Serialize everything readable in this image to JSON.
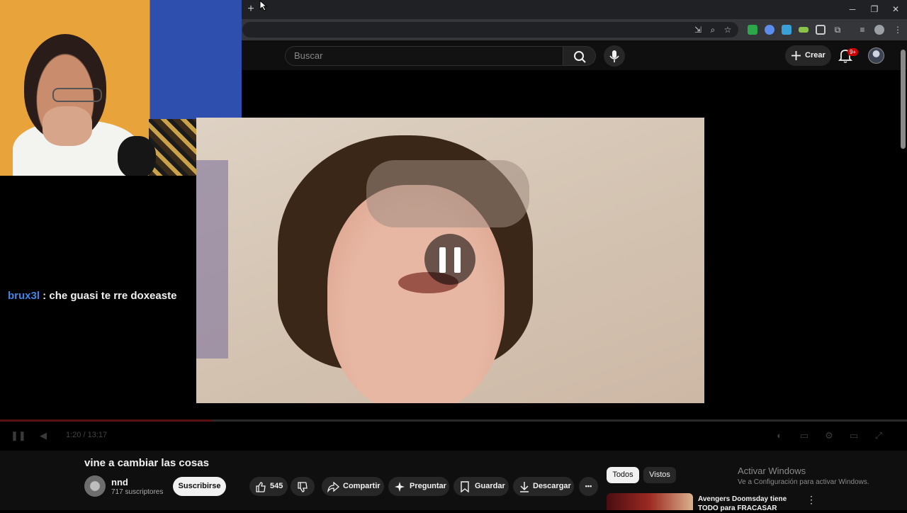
{
  "browser": {
    "new_tab_glyph": "+",
    "window_controls": {
      "minimize": "─",
      "restore": "❐",
      "close": "✕"
    }
  },
  "header": {
    "search_placeholder": "Buscar",
    "create_label": "Crear",
    "notifications_badge": "9+"
  },
  "stream_overlay": {
    "chat_user": "brux3l",
    "chat_message": " : che guasi te rre doxeaste"
  },
  "player": {
    "time": "1:20 / 13:17",
    "state": "paused",
    "progress_fraction": 0.1
  },
  "video": {
    "title": "vine a cambiar las cosas",
    "channel_name": "nnd",
    "subscribers": "717 suscriptores",
    "subscribe_label": "Suscribirse",
    "likes": "545",
    "share_label": "Compartir",
    "ask_label": "Preguntar",
    "save_label": "Guardar",
    "download_label": "Descargar",
    "more_label": "•••"
  },
  "recommendations": {
    "chips": [
      "Todos",
      "Vistos"
    ],
    "items": [
      {
        "title": "Avengers Doomsday tiene TODO para FRACASAR"
      }
    ]
  },
  "watermark": {
    "line1": "Activar Windows",
    "line2": "Ve a Configuración para activar Windows."
  },
  "colors": {
    "chat_user": "#3f86e6",
    "notification_badge": "#cc0000",
    "background": "#0f0f0f"
  }
}
